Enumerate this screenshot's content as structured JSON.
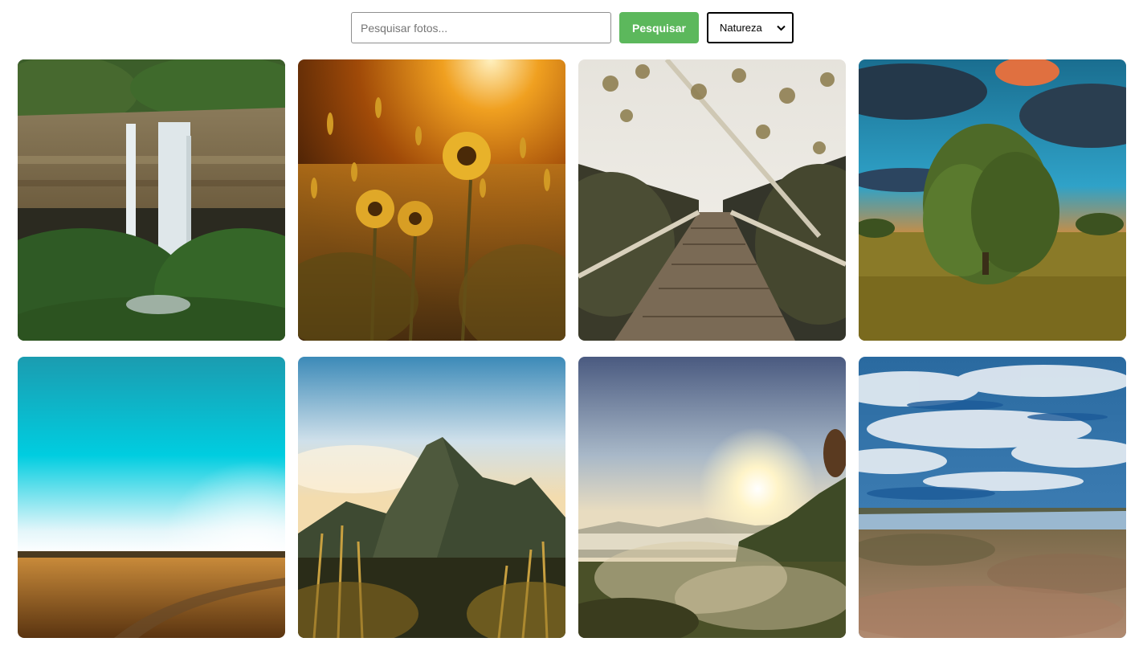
{
  "search": {
    "placeholder": "Pesquisar fotos...",
    "value": "",
    "button_label": "Pesquisar"
  },
  "category": {
    "selected": "Natureza",
    "icon": "chevron-down-icon"
  },
  "colors": {
    "search_button": "#5cb85c",
    "select_border": "#000000"
  },
  "gallery": {
    "photos": [
      {
        "subject": "waterfall"
      },
      {
        "subject": "sunflowers"
      },
      {
        "subject": "wooden-path"
      },
      {
        "subject": "tree"
      },
      {
        "subject": "sky-field"
      },
      {
        "subject": "mountain"
      },
      {
        "subject": "sunrise-valley"
      },
      {
        "subject": "lake-clouds"
      }
    ]
  }
}
